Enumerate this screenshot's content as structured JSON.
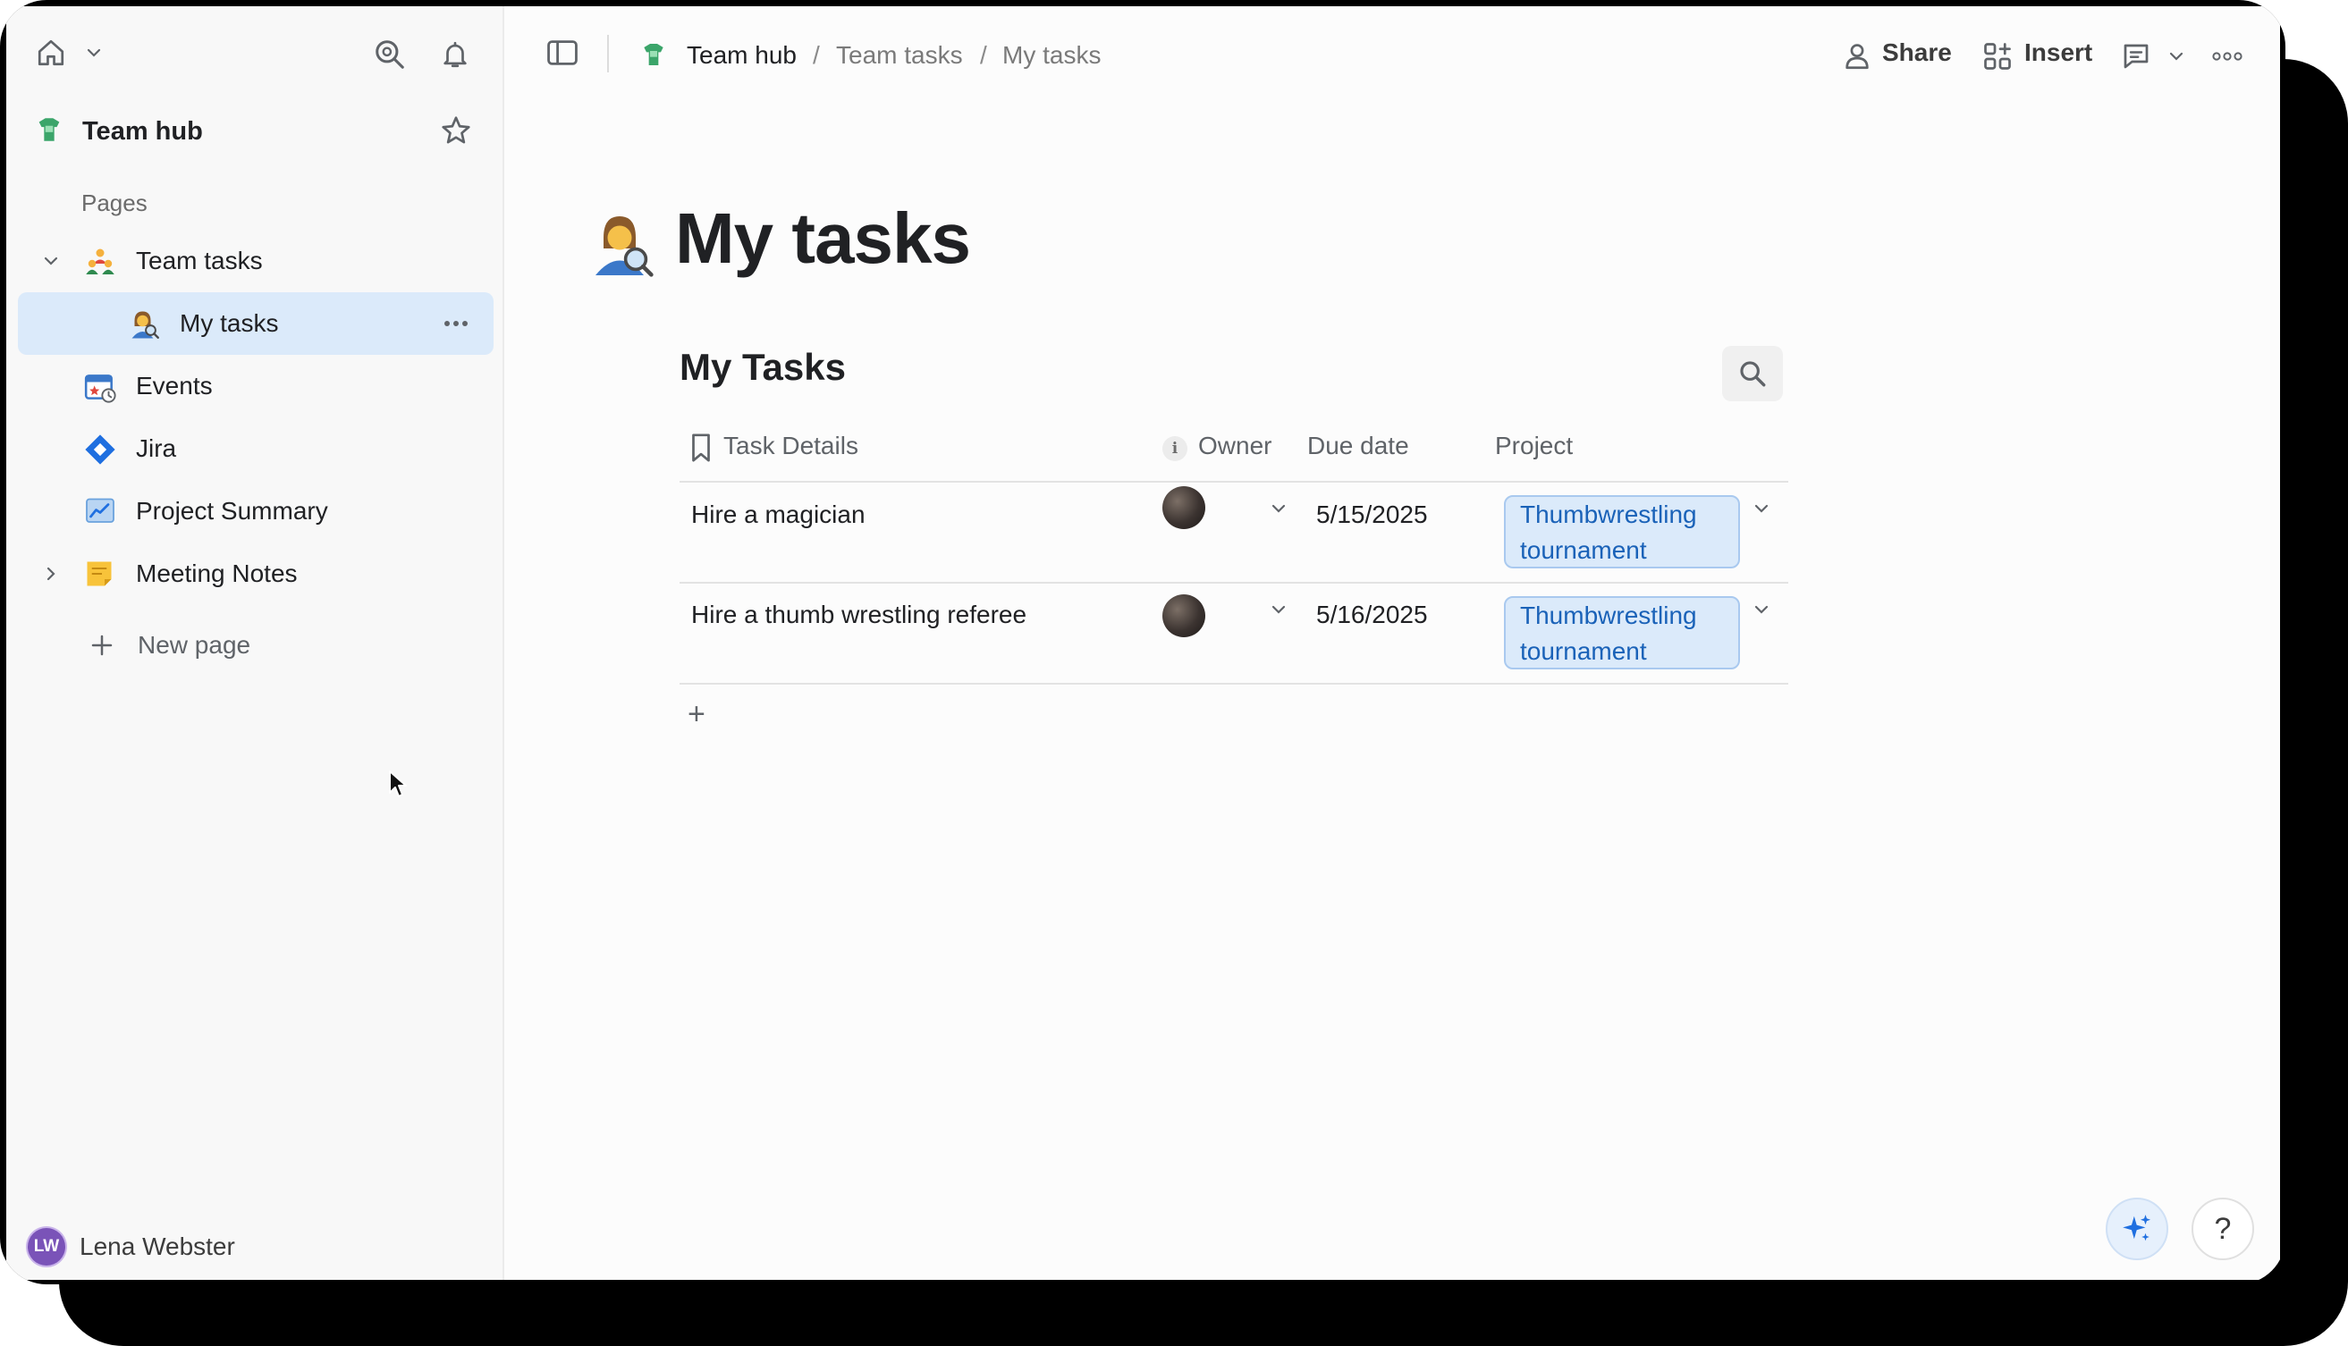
{
  "sidebar": {
    "workspace": "Team hub",
    "pages_heading": "Pages",
    "items": [
      {
        "label": "Team tasks"
      },
      {
        "label": "My tasks"
      },
      {
        "label": "Events"
      },
      {
        "label": "Jira"
      },
      {
        "label": "Project Summary"
      },
      {
        "label": "Meeting Notes"
      }
    ],
    "new_page_label": "New page",
    "user": {
      "initials": "LW",
      "name": "Lena Webster"
    }
  },
  "header": {
    "breadcrumb": [
      "Team hub",
      "Team tasks",
      "My tasks"
    ],
    "separator": "/",
    "share_label": "Share",
    "insert_label": "Insert"
  },
  "page": {
    "title": "My tasks",
    "table": {
      "title": "My Tasks",
      "columns": [
        "Task Details",
        "Owner",
        "Due date",
        "Project"
      ],
      "rows": [
        {
          "task": "Hire a magician",
          "due": "5/15/2025",
          "project": "Thumbwrestling tournament"
        },
        {
          "task": "Hire a thumb wrestling referee",
          "due": "5/16/2025",
          "project": "Thumbwrestling tournament"
        }
      ],
      "add_row_label": "+"
    }
  },
  "help_label": "?",
  "colors": {
    "accent": "#1a62b8",
    "selected_bg": "#dbeafa",
    "sidebar_bg": "#f8f8f8"
  }
}
